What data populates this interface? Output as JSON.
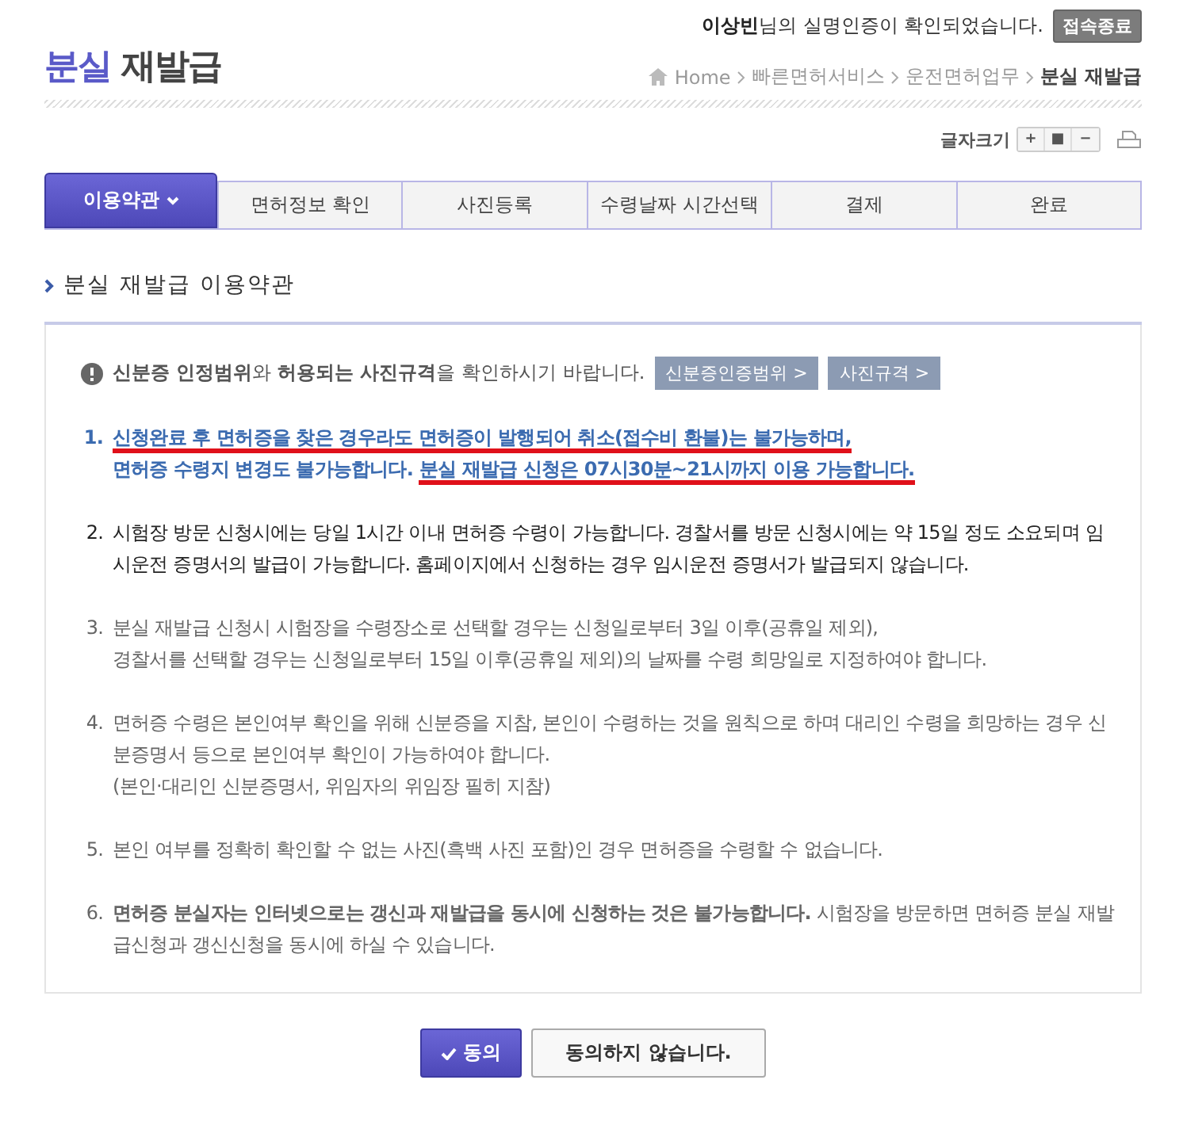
{
  "login_notice": {
    "user": "이상빈",
    "message": "님의 실명인증이 확인되었습니다.",
    "logout_button": "접속종료"
  },
  "page_title": {
    "accent": "분실",
    "rest": "재발급"
  },
  "breadcrumb": [
    "Home",
    "빠른면허서비스",
    "운전면허업무",
    "분실 재발급"
  ],
  "font_size": {
    "label": "글자크기",
    "buttons": [
      "+",
      "■",
      "−"
    ]
  },
  "steps": [
    {
      "label": "이용약관",
      "selected": true
    },
    {
      "label": "면허정보 확인",
      "selected": false
    },
    {
      "label": "사진등록",
      "selected": false
    },
    {
      "label": "수령날짜 시간선택",
      "selected": false
    },
    {
      "label": "결제",
      "selected": false
    },
    {
      "label": "완료",
      "selected": false
    }
  ],
  "section_title": "분실 재발급 이용약관",
  "notice": {
    "text": "**신분증 인정범위**와 **허용되는 사진규격**을 확인하시기 바랍니다.",
    "buttons": [
      "신분증인증범위 >",
      "사진규격 >"
    ]
  },
  "terms": [
    {
      "number": "1.",
      "kind": "emphasis",
      "segment_lines": [
        [
          {
            "text": "신청완료 후 면허증을 찾은 경우라도 면허증이 발행되어 취소(접수비 환불)는 불가능하며,",
            "underlined": true
          }
        ],
        [
          {
            "text": "면허증 수령지 변경도 불가능합니다.",
            "underlined": false
          },
          {
            "text": "분실 재발급 신청은 07시30분~21시까지 이용 가능합니다.",
            "underlined": true
          }
        ]
      ]
    },
    {
      "number": "2.",
      "kind": "dark",
      "lines": [
        "시험장 방문 신청시에는 당일 1시간 이내 면허증 수령이 가능합니다. 경찰서를 방문 신청시에는 약 15일 정도 소요되며 임시운전 증명서의 발급이 가능합니다. 홈페이지에서 신청하는 경우 임시운전 증명서가 발급되지 않습니다."
      ]
    },
    {
      "number": "3.",
      "kind": "muted",
      "lines": [
        "분실 재발급 신청시 시험장을 수령장소로 선택할 경우는 신청일로부터 3일 이후(공휴일 제외),",
        "경찰서를 선택할 경우는 신청일로부터 15일 이후(공휴일 제외)의 날짜를 수령 희망일로 지정하여야 합니다."
      ]
    },
    {
      "number": "4.",
      "kind": "muted",
      "lines": [
        "면허증 수령은 본인여부 확인을 위해 신분증을 지참, 본인이 수령하는 것을 원칙으로 하며 대리인 수령을 희망하는 경우 신분증명서 등으로 본인여부 확인이 가능하여야 합니다.",
        "(본인·대리인 신분증명서, 위임자의 위임장 필히 지참)"
      ]
    },
    {
      "number": "5.",
      "kind": "muted",
      "lines": [
        "본인 여부를 정확히 확인할 수 없는 사진(흑백 사진 포함)인 경우 면허증을 수령할 수 없습니다."
      ]
    },
    {
      "number": "6.",
      "kind": "muted",
      "lines": [
        "**면허증 분실자는 인터넷으로는 갱신과 재발급을 동시에 신청하는 것은 불가능합니다.** 시험장을 방문하면 면허증 분실 재발급신청과 갱신신청을 동시에 하실 수 있습니다."
      ]
    }
  ],
  "actions": {
    "agree": "동의",
    "disagree": "동의하지 않습니다."
  }
}
